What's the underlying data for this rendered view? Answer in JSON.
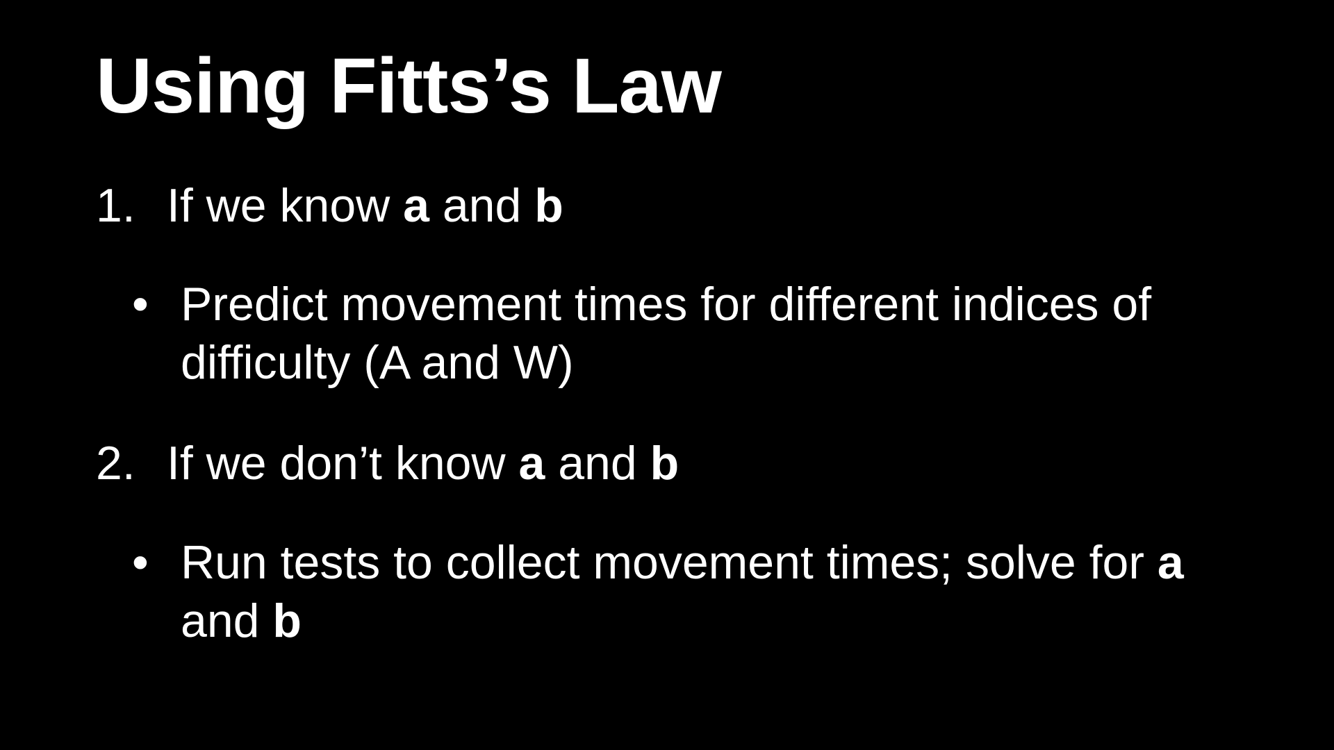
{
  "slide": {
    "title": "Using Fitts’s Law",
    "items": [
      {
        "number": "1.",
        "text_before": "If we know ",
        "bold_a": "a",
        "text_mid": " and ",
        "bold_b": "b",
        "bullet": {
          "symbol": "•",
          "text": "Predict movement times for different indices of difficulty (A and W)"
        }
      },
      {
        "number": "2.",
        "text_before": "If we don’t know ",
        "bold_a": "a",
        "text_mid": " and ",
        "bold_b": "b",
        "bullet": {
          "symbol": "•",
          "text_before": "Run tests to collect movement times; solve for ",
          "bold_a": "a",
          "text_mid": " and ",
          "bold_b": "b"
        }
      }
    ]
  },
  "colors": {
    "background": "#000000",
    "text": "#ffffff"
  }
}
